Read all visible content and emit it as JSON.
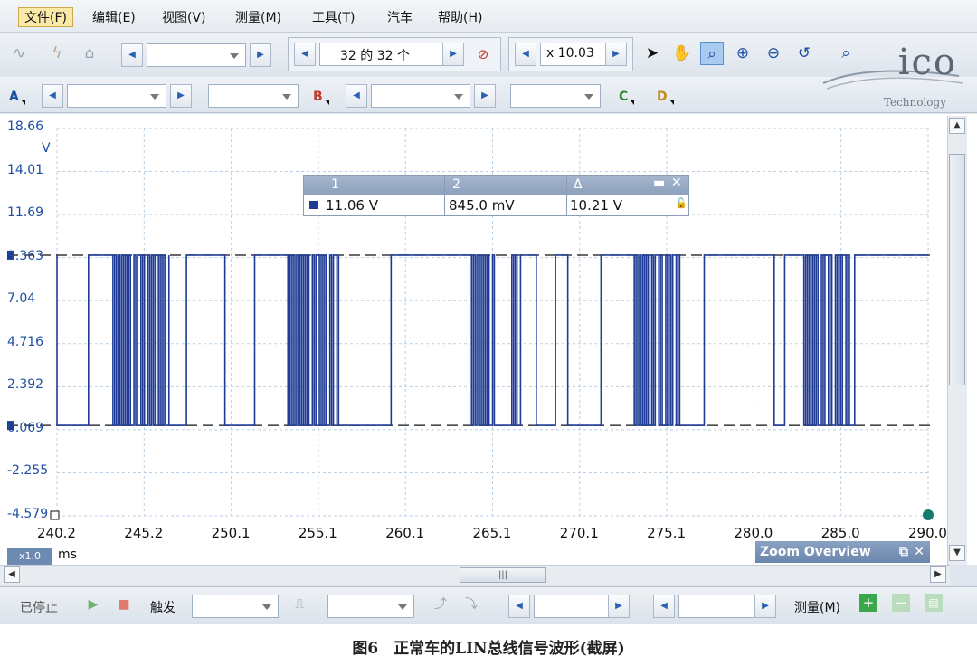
{
  "menu": [
    "文件(F)",
    "编辑(E)",
    "视图(V)",
    "测量(M)",
    "工具(T)",
    "汽车",
    "帮助(H)"
  ],
  "toolbar": {
    "waveform_count": "32 的 32 个",
    "zoom_factor": "x 10.03"
  },
  "channels": {
    "a": "A",
    "b": "B",
    "c": "C",
    "d": "D"
  },
  "logo": {
    "text": "ico",
    "sub": "Technology"
  },
  "chart_data": {
    "type": "line",
    "y_unit": "V",
    "x_unit": "ms",
    "x_ticks": [
      "240.2",
      "245.2",
      "250.1",
      "255.1",
      "260.1",
      "265.1",
      "270.1",
      "275.1",
      "280.0",
      "285.0",
      "290.0"
    ],
    "y_ticks": [
      "18.66",
      "14.01",
      "11.69",
      "9.363",
      "7.04",
      "4.716",
      "2.392",
      "0.069",
      "-2.255",
      "-4.579"
    ],
    "xlim": [
      240.2,
      290.0
    ],
    "ylim": [
      -4.579,
      18.66
    ],
    "grid": true,
    "series": [
      {
        "color": "#1e3b96",
        "high": 11.06,
        "low": 0.845
      }
    ],
    "frames": [
      {
        "start": 240.2,
        "high": [
          [
            240.2,
            242.0
          ],
          [
            246.6,
            247.6
          ],
          [
            249.8,
            251.5
          ],
          [
            256.3,
            259.3
          ],
          [
            265.2,
            266.2
          ],
          [
            267.6,
            268.7
          ],
          [
            269.4,
            271.3
          ],
          [
            275.9,
            277.2
          ],
          [
            281.2,
            281.8
          ],
          [
            285.6,
            285.8
          ]
        ]
      },
      {
        "start": 243.4,
        "bits": [
          1,
          0,
          1,
          0,
          1,
          0,
          1,
          0,
          1,
          0,
          1,
          1,
          0,
          1,
          0,
          0,
          1,
          0,
          1,
          1,
          0,
          1,
          0,
          1,
          0,
          0,
          1,
          0,
          1,
          0,
          1,
          1,
          0,
          1,
          0,
          0,
          1,
          0,
          1
        ]
      },
      {
        "start": 253.4,
        "bits": [
          1,
          0,
          1,
          0,
          1,
          0,
          1,
          0,
          1,
          0,
          1,
          0,
          1,
          1,
          0,
          1,
          0,
          0,
          1,
          0,
          1,
          0,
          1,
          1,
          0,
          1,
          0,
          0,
          1,
          0,
          1,
          0,
          1
        ]
      },
      {
        "start": 263.9,
        "bits": [
          1,
          0,
          1,
          0,
          1,
          0,
          1,
          0,
          1,
          0,
          1,
          1,
          0,
          0,
          1,
          0,
          1,
          1,
          0,
          1,
          0,
          1,
          0,
          0,
          1,
          0,
          1,
          1,
          0
        ]
      },
      {
        "start": 273.2,
        "bits": [
          1,
          0,
          1,
          0,
          1,
          0,
          1,
          0,
          1,
          1,
          0,
          1,
          0,
          0,
          1,
          0,
          1,
          1,
          0,
          1,
          0,
          1,
          0,
          0,
          1,
          0,
          1,
          1,
          0,
          1,
          0,
          1,
          0
        ]
      },
      {
        "start": 282.9,
        "bits": [
          1,
          0,
          1,
          0,
          1,
          0,
          1,
          0,
          1,
          1,
          0,
          1,
          0,
          0,
          1,
          0,
          1,
          1,
          0,
          1,
          0,
          1,
          0,
          0,
          1,
          0,
          1
        ]
      }
    ]
  },
  "measurements": {
    "headers": [
      "1",
      "2",
      "Δ"
    ],
    "values": [
      "11.06 V",
      "845.0 mV",
      "10.21 V"
    ]
  },
  "plot": {
    "zoom_badge": "x1.0",
    "zoom_overview": "Zoom Overview"
  },
  "status": {
    "stopped": "已停止",
    "trigger": "触发",
    "measure": "测量(M)"
  },
  "caption": "图6　正常车的LIN总线信号波形(截屏)"
}
